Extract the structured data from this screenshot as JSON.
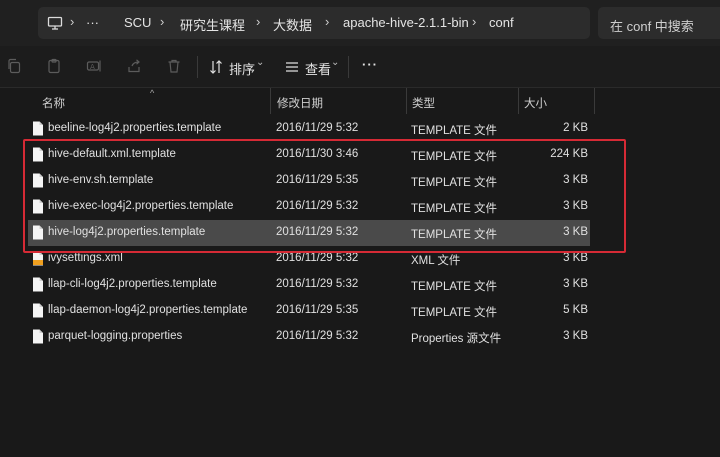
{
  "address_bar": {
    "path": [
      "SCU",
      "研究生课程",
      "大数据",
      "apache-hive-2.1.1-bin",
      "conf"
    ],
    "more": "···"
  },
  "search": {
    "placeholder": "在 conf 中搜索"
  },
  "toolbar": {
    "sort_label": "排序",
    "view_label": "查看",
    "more_label": "···"
  },
  "columns": {
    "name": "名称",
    "date": "修改日期",
    "type": "类型",
    "size": "大小"
  },
  "files": [
    {
      "name": "beeline-log4j2.properties.template",
      "date": "2016/11/29 5:32",
      "type": "TEMPLATE 文件",
      "size": "2 KB"
    },
    {
      "name": "hive-default.xml.template",
      "date": "2016/11/30 3:46",
      "type": "TEMPLATE 文件",
      "size": "224 KB"
    },
    {
      "name": "hive-env.sh.template",
      "date": "2016/11/29 5:35",
      "type": "TEMPLATE 文件",
      "size": "3 KB"
    },
    {
      "name": "hive-exec-log4j2.properties.template",
      "date": "2016/11/29 5:32",
      "type": "TEMPLATE 文件",
      "size": "3 KB"
    },
    {
      "name": "hive-log4j2.properties.template",
      "date": "2016/11/29 5:32",
      "type": "TEMPLATE 文件",
      "size": "3 KB"
    },
    {
      "name": "ivysettings.xml",
      "date": "2016/11/29 5:32",
      "type": "XML 文件",
      "size": "3 KB"
    },
    {
      "name": "llap-cli-log4j2.properties.template",
      "date": "2016/11/29 5:32",
      "type": "TEMPLATE 文件",
      "size": "3 KB"
    },
    {
      "name": "llap-daemon-log4j2.properties.template",
      "date": "2016/11/29 5:35",
      "type": "TEMPLATE 文件",
      "size": "5 KB"
    },
    {
      "name": "parquet-logging.properties",
      "date": "2016/11/29 5:32",
      "type": "Properties 源文件",
      "size": "3 KB"
    }
  ],
  "selected_file": "hive-log4j2.properties.template",
  "highlighted_files": [
    "hive-default.xml.template",
    "hive-env.sh.template",
    "hive-exec-log4j2.properties.template",
    "hive-log4j2.properties.template"
  ],
  "colors": {
    "background": "#191919",
    "selection": "#4a4a4a",
    "highlight_box": "#d62a35",
    "xml_icon_accent": "#f0a020"
  },
  "icons": {
    "address": "computer-icon",
    "toolbar": [
      "copy-icon",
      "paste-icon",
      "rename-icon",
      "share-icon",
      "delete-icon",
      "sort-icon",
      "view-icon"
    ],
    "file": "document-icon",
    "xml_file": "xml-document-icon"
  }
}
